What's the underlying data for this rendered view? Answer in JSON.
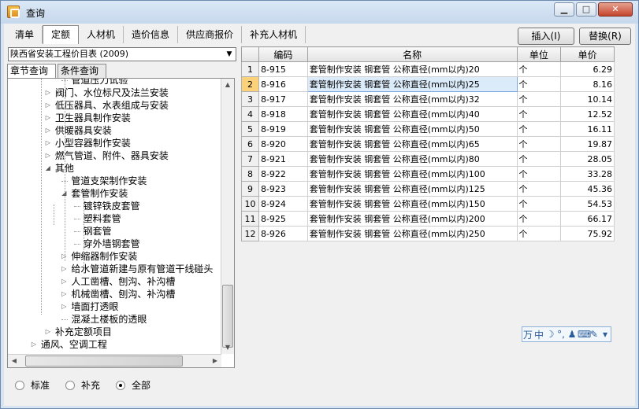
{
  "window": {
    "title": "查询",
    "min": "▁",
    "max": "□",
    "close": "✕"
  },
  "tabs": [
    {
      "label": "清单"
    },
    {
      "label": "定额"
    },
    {
      "label": "人材机"
    },
    {
      "label": "造价信息"
    },
    {
      "label": "供应商报价"
    },
    {
      "label": "补充人材机"
    }
  ],
  "buttons": {
    "insert": "插入(I)",
    "replace": "替换(R)"
  },
  "combo": {
    "value": "陕西省安装工程价目表 (2009)"
  },
  "subtabs": [
    "章节查询",
    "条件查询"
  ],
  "tree": [
    {
      "label": "管道压力试验",
      "indent": 3,
      "exp": ""
    },
    {
      "label": "阀门、水位标尺及法兰安装",
      "indent": 2,
      "exp": "▷"
    },
    {
      "label": "低压器具、水表组成与安装",
      "indent": 2,
      "exp": "▷"
    },
    {
      "label": "卫生器具制作安装",
      "indent": 2,
      "exp": "▷"
    },
    {
      "label": "供暖器具安装",
      "indent": 2,
      "exp": "▷"
    },
    {
      "label": "小型容器制作安装",
      "indent": 2,
      "exp": "▷"
    },
    {
      "label": "燃气管道、附件、器具安装",
      "indent": 2,
      "exp": "▷"
    },
    {
      "label": "其他",
      "indent": 2,
      "exp": "◢"
    },
    {
      "label": "管道支架制作安装",
      "indent": 3,
      "exp": ""
    },
    {
      "label": "套管制作安装",
      "indent": 3,
      "exp": "◢"
    },
    {
      "label": "镀锌铁皮套管",
      "indent": 4,
      "exp": ""
    },
    {
      "label": "塑料套管",
      "indent": 4,
      "exp": ""
    },
    {
      "label": "钢套管",
      "indent": 4,
      "exp": ""
    },
    {
      "label": "穿外墙钢套管",
      "indent": 4,
      "exp": ""
    },
    {
      "label": "伸缩器制作安装",
      "indent": 3,
      "exp": "▷"
    },
    {
      "label": "给水管道新建与原有管道干线碰头",
      "indent": 3,
      "exp": "▷"
    },
    {
      "label": "人工凿槽、刨沟、补沟槽",
      "indent": 3,
      "exp": "▷"
    },
    {
      "label": "机械凿槽、刨沟、补沟槽",
      "indent": 3,
      "exp": "▷"
    },
    {
      "label": "墙面打透眼",
      "indent": 3,
      "exp": "▷"
    },
    {
      "label": "混凝土楼板的透眼",
      "indent": 3,
      "exp": ""
    },
    {
      "label": "补充定额项目",
      "indent": 2,
      "exp": "▷"
    },
    {
      "label": "通风、空调工程",
      "indent": 1,
      "exp": "▷"
    }
  ],
  "radios": [
    {
      "label": "标准",
      "checked": false
    },
    {
      "label": "补充",
      "checked": false
    },
    {
      "label": "全部",
      "checked": true
    }
  ],
  "table": {
    "headers": [
      "编码",
      "名称",
      "单位",
      "单价"
    ],
    "rows": [
      [
        "1",
        "8-915",
        "套管制作安装 钢套管 公称直径(mm以内)20",
        "个",
        "6.29"
      ],
      [
        "2",
        "8-916",
        "套管制作安装 钢套管 公称直径(mm以内)25",
        "个",
        "8.16"
      ],
      [
        "3",
        "8-917",
        "套管制作安装 钢套管 公称直径(mm以内)32",
        "个",
        "10.14"
      ],
      [
        "4",
        "8-918",
        "套管制作安装 钢套管 公称直径(mm以内)40",
        "个",
        "12.52"
      ],
      [
        "5",
        "8-919",
        "套管制作安装 钢套管 公称直径(mm以内)50",
        "个",
        "16.11"
      ],
      [
        "6",
        "8-920",
        "套管制作安装 钢套管 公称直径(mm以内)65",
        "个",
        "19.87"
      ],
      [
        "7",
        "8-921",
        "套管制作安装 钢套管 公称直径(mm以内)80",
        "个",
        "28.05"
      ],
      [
        "8",
        "8-922",
        "套管制作安装 钢套管 公称直径(mm以内)100",
        "个",
        "33.28"
      ],
      [
        "9",
        "8-923",
        "套管制作安装 钢套管 公称直径(mm以内)125",
        "个",
        "45.36"
      ],
      [
        "10",
        "8-924",
        "套管制作安装 钢套管 公称直径(mm以内)150",
        "个",
        "54.53"
      ],
      [
        "11",
        "8-925",
        "套管制作安装 钢套管 公称直径(mm以内)200",
        "个",
        "66.17"
      ],
      [
        "12",
        "8-926",
        "套管制作安装 钢套管 公称直径(mm以内)250",
        "个",
        "75.92"
      ]
    ],
    "selected_row": 2
  },
  "ime": {
    "items": [
      "万",
      "中",
      "☽",
      "°,",
      "♟",
      "⌨",
      "✎",
      "▾"
    ]
  }
}
